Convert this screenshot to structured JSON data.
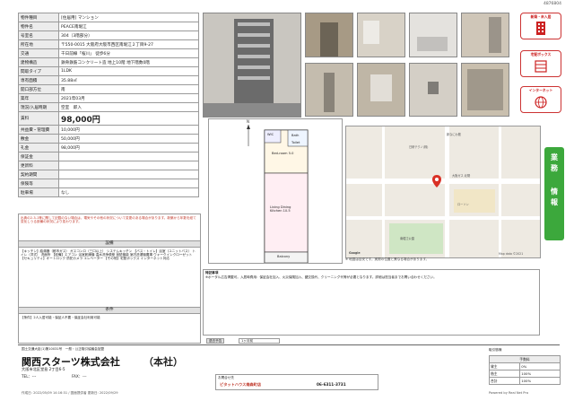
{
  "doc_number": "4876804",
  "spec": {
    "rows": [
      {
        "key": "物件種目",
        "value": "[住居用] マンション"
      },
      {
        "key": "物件名",
        "value": "PEACE南堀江"
      },
      {
        "key": "号室名",
        "value": "304（3階部分）"
      },
      {
        "key": "所在地",
        "value": "〒550-0015 大阪府大阪市西区南堀江２丁目9-27"
      },
      {
        "key": "交通",
        "value": "千日前線「桜川」 徒歩6分"
      },
      {
        "key": "建物構造",
        "value": "鉄骨鉄筋コンクリート造 地上10階 地下階数0階"
      },
      {
        "key": "間取タイプ",
        "value": "1LDK"
      },
      {
        "key": "専有面積",
        "value": "35.88㎡"
      },
      {
        "key": "開口部方位",
        "value": "南"
      },
      {
        "key": "築年",
        "value": "2021年03月"
      },
      {
        "key": "現況/入居時期",
        "value": "空室　即入"
      }
    ],
    "rent_label": "賃料",
    "rent_value": "98,000円",
    "fee_rows": [
      {
        "key": "共益費・管理費",
        "value": "10,000円"
      },
      {
        "key": "敷金",
        "value": "50,000円"
      },
      {
        "key": "礼金",
        "value": "98,000円"
      },
      {
        "key": "保証金",
        "value": "",
        "key2": "償却・敷引",
        "value2": ""
      },
      {
        "key": "更新料",
        "value": ""
      },
      {
        "key": "契約期間",
        "value": ""
      },
      {
        "key": "保険等",
        "value": ""
      },
      {
        "key": "駐車場",
        "value": "なし"
      }
    ]
  },
  "notes_text": "出典の2-3-1等に関して記載のない場合は、電気やその他の状況について変更のある場合があります。新築から年数を経て変化しうる設備の状況により変わります。",
  "equipment_header": "設備",
  "equipment_text": "【キッチン】給湯器（都市ガス） ガスコンロ（三口以上） システムキッチン 【バス・トイレ】浴室（ユニットバス） トイレ（洋式） 洗面所 【設備】エアコン 浴室乾燥機 温水洗浄便座 追焚機能 室内洗濯機置場 ウォークインクローゼット 【セキュリティ】オートロック 防犯カメラ エレベーター 【その他】宅配ボックス インターネット対応",
  "conditions_header": "条件",
  "conditions_text": "【条件】2人入居可能・保証人不要・保証会社利用可能",
  "floorplan": {
    "rooms": [
      "Bed-room 5.0",
      "Living Dining Kitchen 10.5",
      "Balcony",
      "WIC",
      "Bath",
      "Toilet"
    ]
  },
  "notes2_header": "特記事項",
  "notes2_text": "※ポータル広告掲載可。入居時費用：保証会社加入、火災保険加入、鍵交換代、クリーニング代等が必要となります。詳細は担当者までお問い合わせください。",
  "move_label": "退去予告",
  "move_value": "1ヶ月前",
  "map_note": "※ 地図は目安です。実際の位置と異なる場合があります。",
  "map_labels": [
    "Google",
    "日研テクノ(株)",
    "大阪ガス 北陽",
    "ローソン",
    "南堀江公園",
    "新なにわ筋",
    "Map data ©2021"
  ],
  "badges": [
    "新築・未入居",
    "宅配ボックス",
    "インターネット"
  ],
  "sidebar_chars": [
    "業",
    "務",
    "情",
    "報"
  ],
  "footer": {
    "licence": "国土交通大臣(1)第10031号　一般・公正取引協議会加盟",
    "company": "関西スターツ株式会社",
    "branch": "（本社）",
    "address": "大阪市北区堂島 2丁目6-5",
    "tel": "TEL：---",
    "fax": "FAX：---",
    "contact_label": "お問合せ先",
    "contact_name": "ピタットハウス南森町店",
    "contact_tel": "06-6311-3731",
    "print_line": "作成日: 2022/05/09 14:16:31 / 図面提供者 更新日: 2022/09/29",
    "powered": "Powered by Real Net Pro"
  },
  "brokerage": {
    "title": "取引態様",
    "header": "手数料",
    "rows": [
      [
        "貸主",
        "0%"
      ],
      [
        "借主",
        "100%"
      ],
      [
        "合計",
        "100%"
      ]
    ]
  }
}
